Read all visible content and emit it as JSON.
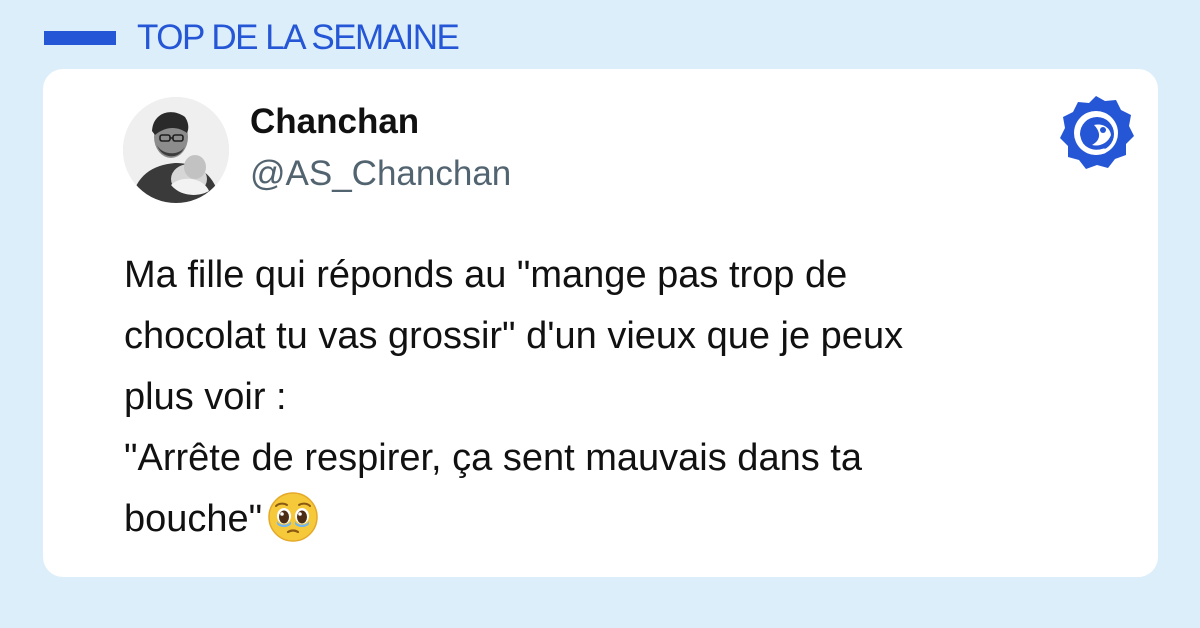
{
  "header": {
    "title": "TOP DE LA SEMAINE"
  },
  "tweet": {
    "author": {
      "name": "Chanchan",
      "handle": "@AS_Chanchan"
    },
    "lines": [
      "Ma fille qui réponds au \"mange pas trop de",
      "chocolat tu vas grossir\" d'un vieux que je peux",
      "plus voir :",
      "\"Arrête de respirer, ça sent mauvais dans ta",
      "bouche\""
    ],
    "emoji": "pleading-face-with-tears-icon"
  },
  "colors": {
    "background": "#ddeefb",
    "accent": "#2456d6",
    "card": "#ffffff",
    "handle": "#536471"
  }
}
